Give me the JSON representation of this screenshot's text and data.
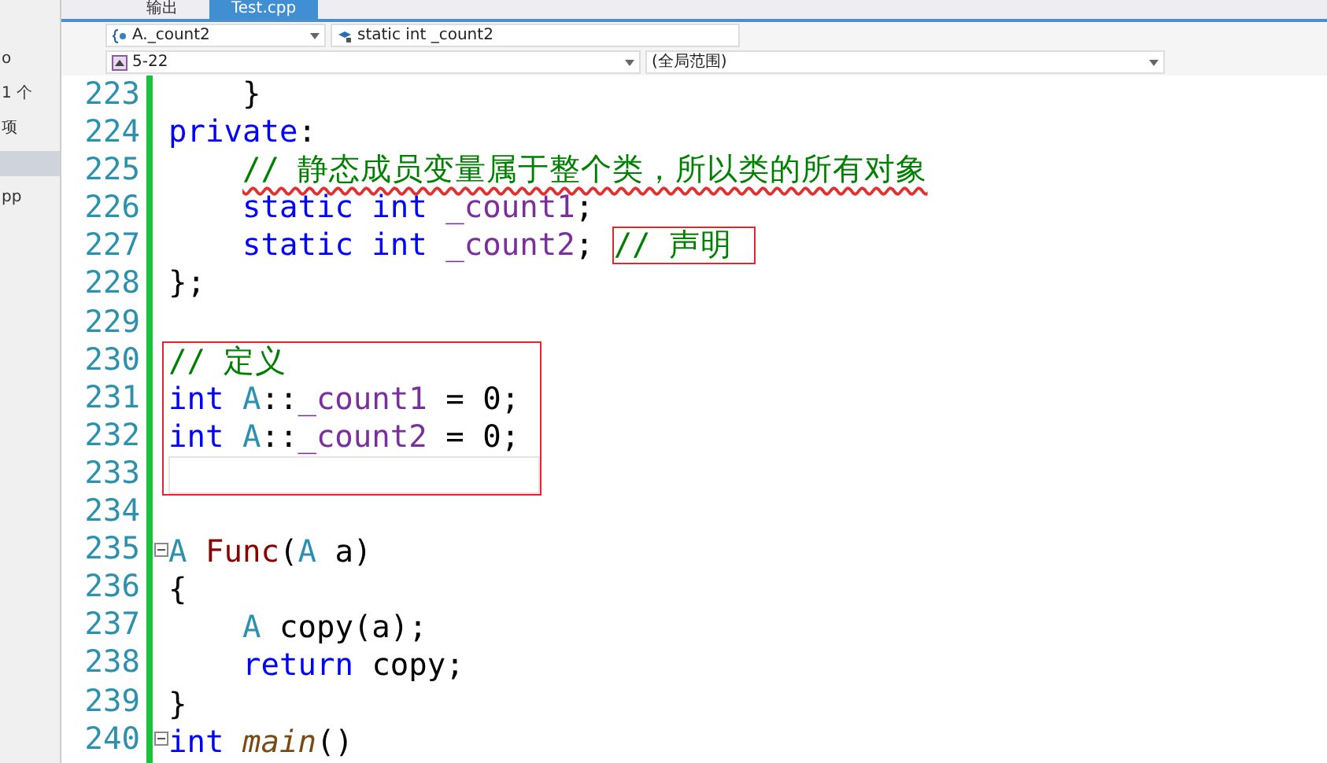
{
  "tabs": [
    {
      "label": "输出",
      "selected": false
    },
    {
      "label": "Test.cpp",
      "selected": true
    }
  ],
  "side_panel": {
    "items": [
      {
        "label": "o",
        "selected": false
      },
      {
        "label": "1 个",
        "selected": false
      },
      {
        "label": "项",
        "selected": false
      },
      {
        "selected": true
      },
      {
        "label": "pp",
        "selected": false
      }
    ]
  },
  "nav_bar": {
    "class_dropdown": "A._count2",
    "member_dropdown": "static int _count2",
    "config_dropdown": "5-22",
    "scope_dropdown": "(全局范围)"
  },
  "editor": {
    "lines": [
      {
        "number": "223",
        "indent": true,
        "tokens": [
          {
            "kind": "plain",
            "text": "}"
          }
        ]
      },
      {
        "number": "224",
        "tokens": [
          {
            "kind": "keyword",
            "text": "private"
          },
          {
            "kind": "plain",
            "text": ":"
          }
        ]
      },
      {
        "number": "225",
        "indent": true,
        "tokens": [
          {
            "kind": "comment",
            "text": "// 静态成员变量属于整个类，所以类的所有对象",
            "squiggle": true
          }
        ]
      },
      {
        "number": "226",
        "indent": true,
        "tokens": [
          {
            "kind": "keyword",
            "text": "static int "
          },
          {
            "kind": "member",
            "text": "_count1"
          },
          {
            "kind": "plain",
            "text": ";"
          }
        ]
      },
      {
        "number": "227",
        "indent": true,
        "tokens": [
          {
            "kind": "keyword",
            "text": "static int "
          },
          {
            "kind": "member",
            "text": "_count2"
          },
          {
            "kind": "plain",
            "text": "; "
          },
          {
            "kind": "comment",
            "text": "// 声明",
            "boxed": true
          }
        ]
      },
      {
        "number": "228",
        "tokens": [
          {
            "kind": "plain",
            "text": "};"
          }
        ]
      },
      {
        "number": "229"
      },
      {
        "number": "230",
        "boxed": true,
        "tokens": [
          {
            "kind": "comment",
            "text": "// 定义"
          }
        ]
      },
      {
        "number": "231",
        "boxed": true,
        "tokens": [
          {
            "kind": "keyword",
            "text": "int "
          },
          {
            "kind": "type",
            "text": "A"
          },
          {
            "kind": "plain",
            "text": "::"
          },
          {
            "kind": "member",
            "text": "_count1"
          },
          {
            "kind": "plain",
            "text": " = 0;"
          }
        ]
      },
      {
        "number": "232",
        "boxed": true,
        "tokens": [
          {
            "kind": "keyword",
            "text": "int "
          },
          {
            "kind": "type",
            "text": "A"
          },
          {
            "kind": "plain",
            "text": "::"
          },
          {
            "kind": "member",
            "text": "_count2"
          },
          {
            "kind": "plain",
            "text": " = 0;"
          }
        ]
      },
      {
        "number": "233",
        "boxed": true,
        "current": true
      },
      {
        "number": "234"
      },
      {
        "number": "235",
        "fold": true,
        "tokens": [
          {
            "kind": "type",
            "text": "A "
          },
          {
            "kind": "function",
            "text": "Func"
          },
          {
            "kind": "plain",
            "text": "("
          },
          {
            "kind": "type",
            "text": "A "
          },
          {
            "kind": "plain",
            "text": "a)"
          }
        ]
      },
      {
        "number": "236",
        "tokens": [
          {
            "kind": "plain",
            "text": "{"
          }
        ]
      },
      {
        "number": "237",
        "indent": true,
        "tokens": [
          {
            "kind": "type",
            "text": "A "
          },
          {
            "kind": "plain",
            "text": "copy(a);"
          }
        ]
      },
      {
        "number": "238",
        "indent": true,
        "tokens": [
          {
            "kind": "keyword",
            "text": "return "
          },
          {
            "kind": "plain",
            "text": "copy;"
          }
        ]
      },
      {
        "number": "239",
        "tokens": [
          {
            "kind": "plain",
            "text": "}"
          }
        ]
      },
      {
        "number": "240",
        "fold": true,
        "tokens": [
          {
            "kind": "keyword",
            "text": "int "
          },
          {
            "kind": "function-italic",
            "text": "main"
          },
          {
            "kind": "plain",
            "text": "()"
          }
        ]
      }
    ]
  }
}
